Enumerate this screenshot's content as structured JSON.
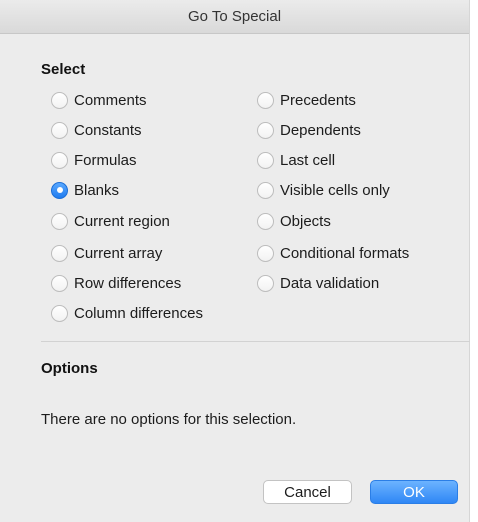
{
  "window": {
    "title": "Go To Special"
  },
  "select_section": {
    "title": "Select",
    "left_options": [
      {
        "label": "Comments",
        "checked": false
      },
      {
        "label": "Constants",
        "checked": false
      },
      {
        "label": "Formulas",
        "checked": false
      },
      {
        "label": "Blanks",
        "checked": true
      },
      {
        "label": "Current region",
        "checked": false
      },
      {
        "label": "Current array",
        "checked": false
      },
      {
        "label": "Row differences",
        "checked": false
      },
      {
        "label": "Column differences",
        "checked": false
      }
    ],
    "right_options": [
      {
        "label": "Precedents",
        "checked": false
      },
      {
        "label": "Dependents",
        "checked": false
      },
      {
        "label": "Last cell",
        "checked": false
      },
      {
        "label": "Visible cells only",
        "checked": false
      },
      {
        "label": "Objects",
        "checked": false
      },
      {
        "label": "Conditional formats",
        "checked": false
      },
      {
        "label": "Data validation",
        "checked": false
      }
    ]
  },
  "options_section": {
    "title": "Options",
    "message": "There are no options for this selection."
  },
  "buttons": {
    "cancel_label": "Cancel",
    "ok_label": "OK"
  },
  "colors": {
    "accent": "#2f87f5",
    "dialog_bg": "#ececec"
  }
}
